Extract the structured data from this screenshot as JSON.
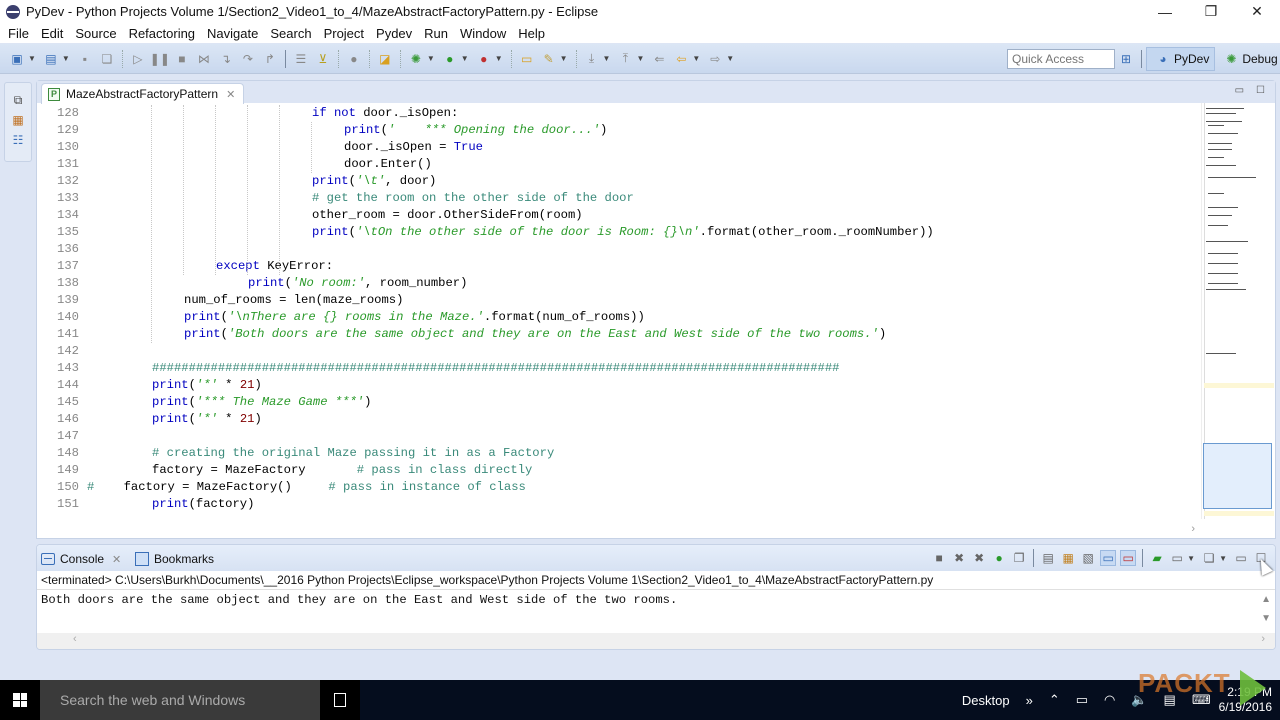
{
  "window": {
    "title": "PyDev - Python Projects Volume 1/Section2_Video1_to_4/MazeAbstractFactoryPattern.py - Eclipse",
    "minimize": "—",
    "restore": "❐",
    "close": "✕"
  },
  "menu": [
    "File",
    "Edit",
    "Source",
    "Refactoring",
    "Navigate",
    "Search",
    "Project",
    "Pydev",
    "Run",
    "Window",
    "Help"
  ],
  "toolbar": {
    "quick_access_placeholder": "Quick Access",
    "perspectives": [
      {
        "label": "PyDev",
        "icon": "python-icon",
        "active": true
      },
      {
        "label": "Debug",
        "icon": "bug-icon",
        "active": false
      }
    ]
  },
  "editor": {
    "tab_label": "MazeAbstractFactoryPattern",
    "tab_icon": "P",
    "lines": [
      {
        "n": "128",
        "indent": 6,
        "tokens": [
          [
            "kw",
            "if not"
          ],
          [
            "",
            " door._isOpen:"
          ]
        ]
      },
      {
        "n": "129",
        "indent": 7,
        "tokens": [
          [
            "kw",
            "print"
          ],
          [
            "",
            "("
          ],
          [
            "str",
            "'    *** Opening the door...'"
          ],
          [
            "",
            ")"
          ]
        ]
      },
      {
        "n": "130",
        "indent": 7,
        "tokens": [
          [
            "",
            "door._isOpen = "
          ],
          [
            "kw",
            "True"
          ]
        ]
      },
      {
        "n": "131",
        "indent": 7,
        "tokens": [
          [
            "",
            "door.Enter()"
          ]
        ]
      },
      {
        "n": "132",
        "indent": 6,
        "tokens": [
          [
            "kw",
            "print"
          ],
          [
            "",
            "("
          ],
          [
            "str",
            "'\\t'"
          ],
          [
            "",
            ", door)"
          ]
        ]
      },
      {
        "n": "133",
        "indent": 6,
        "tokens": [
          [
            "cm",
            "# get the room on the other side of the door"
          ]
        ]
      },
      {
        "n": "134",
        "indent": 6,
        "tokens": [
          [
            "",
            "other_room = door.OtherSideFrom(room)"
          ]
        ]
      },
      {
        "n": "135",
        "indent": 6,
        "tokens": [
          [
            "kw",
            "print"
          ],
          [
            "",
            "("
          ],
          [
            "str",
            "'\\tOn the other side of the door is Room: {}\\n'"
          ],
          [
            "",
            ".format(other_room._roomNumber))"
          ]
        ]
      },
      {
        "n": "136",
        "indent": 0,
        "tokens": []
      },
      {
        "n": "137",
        "indent": 3,
        "tokens": [
          [
            "kw",
            "except"
          ],
          [
            "",
            " KeyError:"
          ]
        ]
      },
      {
        "n": "138",
        "indent": 4,
        "tokens": [
          [
            "kw",
            "print"
          ],
          [
            "",
            "("
          ],
          [
            "str",
            "'No room:'"
          ],
          [
            "",
            ", room_number)"
          ]
        ]
      },
      {
        "n": "139",
        "indent": 2,
        "tokens": [
          [
            "",
            "num_of_rooms = len(maze_rooms)"
          ]
        ]
      },
      {
        "n": "140",
        "indent": 2,
        "tokens": [
          [
            "kw",
            "print"
          ],
          [
            "",
            "("
          ],
          [
            "str",
            "'\\nThere are {} rooms in the Maze.'"
          ],
          [
            "",
            ".format(num_of_rooms))"
          ]
        ]
      },
      {
        "n": "141",
        "indent": 2,
        "tokens": [
          [
            "kw",
            "print"
          ],
          [
            "",
            "("
          ],
          [
            "str",
            "'Both doors are the same object and they are on the East and West side of the two rooms.'"
          ],
          [
            "",
            ")"
          ]
        ]
      },
      {
        "n": "142",
        "indent": 0,
        "tokens": []
      },
      {
        "n": "143",
        "indent": 1,
        "tokens": [
          [
            "cm",
            "##############################################################################################"
          ]
        ]
      },
      {
        "n": "144",
        "indent": 1,
        "tokens": [
          [
            "kw",
            "print"
          ],
          [
            "",
            "("
          ],
          [
            "str",
            "'*'"
          ],
          [
            "",
            " * "
          ],
          [
            "num",
            "21"
          ],
          [
            "",
            ")"
          ]
        ]
      },
      {
        "n": "145",
        "indent": 1,
        "tokens": [
          [
            "kw",
            "print"
          ],
          [
            "",
            "("
          ],
          [
            "str",
            "'*** The Maze Game ***'"
          ],
          [
            "",
            ")"
          ]
        ]
      },
      {
        "n": "146",
        "indent": 1,
        "tokens": [
          [
            "kw",
            "print"
          ],
          [
            "",
            "("
          ],
          [
            "str",
            "'*'"
          ],
          [
            "",
            " * "
          ],
          [
            "num",
            "21"
          ],
          [
            "",
            ")"
          ]
        ]
      },
      {
        "n": "147",
        "indent": 0,
        "tokens": []
      },
      {
        "n": "148",
        "indent": 1,
        "tokens": [
          [
            "cm",
            "# creating the original Maze passing it in as a Factory"
          ]
        ]
      },
      {
        "n": "149",
        "indent": 1,
        "tokens": [
          [
            "",
            "factory = MazeFactory       "
          ],
          [
            "cm",
            "# pass in class directly"
          ]
        ]
      },
      {
        "n": "150",
        "indent": 0,
        "tokens": [
          [
            "cm",
            "#    "
          ],
          [
            "",
            "factory = MazeFactory()     "
          ],
          [
            "cm",
            "# pass in instance of class"
          ]
        ]
      },
      {
        "n": "151",
        "indent": 1,
        "tokens": [
          [
            "kw",
            "print"
          ],
          [
            "",
            "(factory)"
          ]
        ]
      }
    ]
  },
  "console": {
    "tabs": [
      {
        "label": "Console",
        "icon": "console-icon",
        "active": true
      },
      {
        "label": "Bookmarks",
        "icon": "bookmarks-icon",
        "active": false
      }
    ],
    "status": "<terminated> C:\\Users\\Burkh\\Documents\\__2016 Python Projects\\Eclipse_workspace\\Python Projects Volume 1\\Section2_Video1_to_4\\MazeAbstractFactoryPattern.py",
    "output": "Both doors are the same object and they are on the East and West side of the two rooms."
  },
  "taskbar": {
    "search_placeholder": "Search the web and Windows",
    "desktop_label": "Desktop",
    "overflow": "»",
    "time": "2:19 PM",
    "date": "6/19/2016",
    "watermark": "PACKT"
  }
}
